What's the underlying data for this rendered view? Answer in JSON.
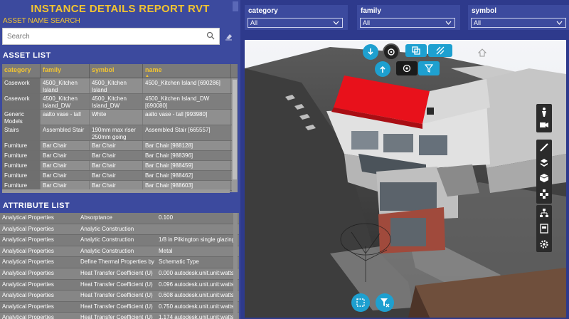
{
  "app": {
    "title": "INSTANCE DETAILS REPORT RVT"
  },
  "search": {
    "label": "ASSET NAME SEARCH",
    "placeholder": "Search",
    "value": ""
  },
  "asset_list": {
    "title": "ASSET LIST",
    "columns": [
      "category",
      "family",
      "symbol",
      "name"
    ],
    "rows": [
      [
        "Casework",
        "4500_Kitchen Island",
        "4500_Kitchen Island",
        "4500_Kitchen Island [690286]"
      ],
      [
        "Casework",
        "4500_Kitchen Island_DW",
        "4500_Kitchen Island_DW",
        "4500_Kitchen Island_DW [690080]"
      ],
      [
        "Generic Models",
        "aalto vase - tall",
        "White",
        "aalto vase - tall [993980]"
      ],
      [
        "Stairs",
        "Assembled Stair",
        "190mm max riser 250mm going",
        "Assembled Stair [665557]"
      ],
      [
        "Furniture",
        "Bar Chair",
        "Bar Chair",
        "Bar Chair [988128]"
      ],
      [
        "Furniture",
        "Bar Chair",
        "Bar Chair",
        "Bar Chair [988396]"
      ],
      [
        "Furniture",
        "Bar Chair",
        "Bar Chair",
        "Bar Chair [988459]"
      ],
      [
        "Furniture",
        "Bar Chair",
        "Bar Chair",
        "Bar Chair [988462]"
      ],
      [
        "Furniture",
        "Bar Chair",
        "Bar Chair",
        "Bar Chair [988603]"
      ]
    ]
  },
  "attribute_list": {
    "title": "ATTRIBUTE LIST",
    "rows": [
      [
        "Analytical Properties",
        "Absorptance",
        "0.100"
      ],
      [
        "Analytical Properties",
        "Analytic Construction",
        ""
      ],
      [
        "Analytical Properties",
        "Analytic Construction",
        "1/8 in Pilkington single glazing"
      ],
      [
        "Analytical Properties",
        "Analytic Construction",
        "Metal"
      ],
      [
        "Analytical Properties",
        "Define Thermal Properties by",
        "Schematic Type"
      ],
      [
        "Analytical Properties",
        "Heat Transfer Coefficient (U)",
        "0.000 autodesk.unit.unit:watts..."
      ],
      [
        "Analytical Properties",
        "Heat Transfer Coefficient (U)",
        "0.096 autodesk.unit.unit:watts..."
      ],
      [
        "Analytical Properties",
        "Heat Transfer Coefficient (U)",
        "0.608 autodesk.unit.unit:watts..."
      ],
      [
        "Analytical Properties",
        "Heat Transfer Coefficient (U)",
        "0.750 autodesk.unit.unit:watts..."
      ],
      [
        "Analytical Properties",
        "Heat Transfer Coefficient (U)",
        "1.174 autodesk.unit.unit:watts..."
      ]
    ]
  },
  "filters": [
    {
      "label": "category",
      "value": "All"
    },
    {
      "label": "family",
      "value": "All"
    },
    {
      "label": "symbol",
      "value": "All"
    }
  ],
  "viewer": {
    "top_tools": [
      "download-icon",
      "orbit-icon",
      "copy-icon",
      "hatch-icon",
      "upload-icon",
      "target-icon",
      "filter-icon"
    ],
    "right_tools": [
      "person-icon",
      "camera-icon",
      "measure-icon",
      "section-icon",
      "cube-icon",
      "explode-icon",
      "tree-icon",
      "properties-icon",
      "settings-icon"
    ],
    "bottom_tools": [
      "select-box-icon",
      "clear-filter-icon"
    ]
  },
  "colors": {
    "accent": "#f2c431",
    "panel": "#3c4a9e",
    "page": "#2e3a8c",
    "tool": "#1ea0d0",
    "roof": "#e8111b"
  }
}
